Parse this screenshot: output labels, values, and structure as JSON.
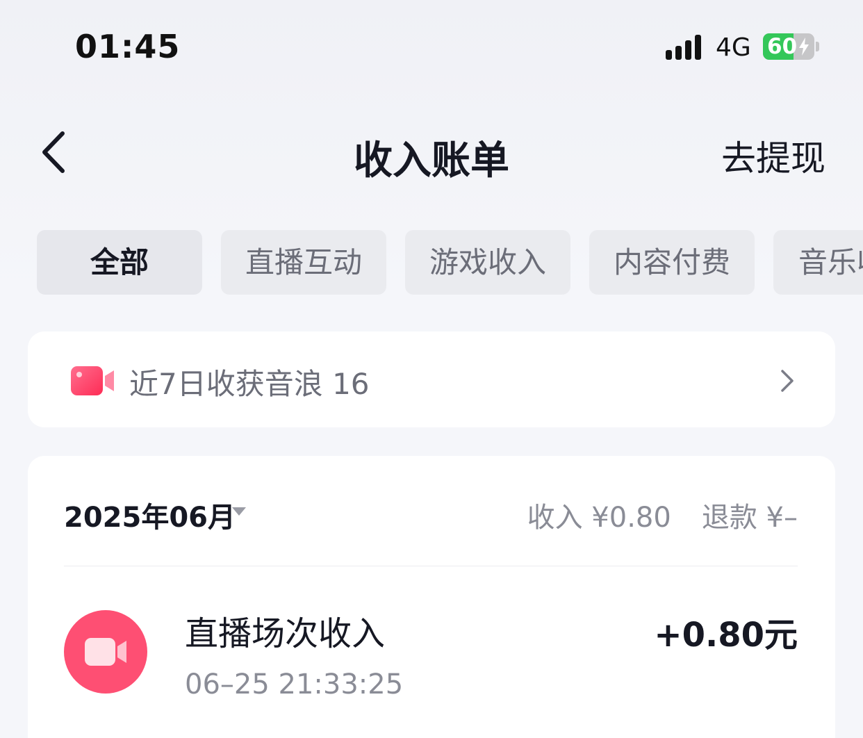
{
  "status_bar": {
    "time": "01:45",
    "network": "4G",
    "battery_percent": "60",
    "battery_level": 0.6,
    "signal_icon": "signal-bars-icon",
    "charging_icon": "bolt-icon"
  },
  "nav": {
    "back_icon": "chevron-left-icon",
    "title": "收入账单",
    "action_label": "去提现"
  },
  "tabs": [
    {
      "label": "全部",
      "active": true
    },
    {
      "label": "直播互动",
      "active": false
    },
    {
      "label": "游戏收入",
      "active": false
    },
    {
      "label": "内容付费",
      "active": false
    },
    {
      "label": "音乐收入",
      "active": false
    }
  ],
  "summary": {
    "icon": "video-camera-icon",
    "text": "近7日收获音浪 16",
    "chevron_icon": "chevron-right-icon"
  },
  "records": {
    "month_label": "2025年06月",
    "caret_icon": "caret-down-icon",
    "income_text": "收入 ¥0.80",
    "refund_text": "退款 ¥–",
    "items": [
      {
        "icon": "video-camera-icon",
        "title": "直播场次收入",
        "time": "06–25 21:33:25",
        "amount": "+0.80元"
      }
    ]
  },
  "colors": {
    "accent_pink": "#fe4f73",
    "battery_green": "#34c759",
    "text_primary": "#161823",
    "text_secondary": "#8a8c96"
  }
}
